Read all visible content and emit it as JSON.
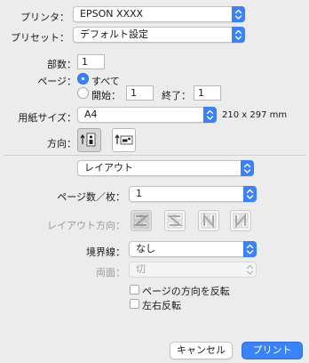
{
  "printer": {
    "label": "プリンタ：",
    "value": "EPSON XXXX"
  },
  "presets": {
    "label": "プリセット：",
    "value": "デフォルト設定"
  },
  "copies": {
    "label": "部数：",
    "value": "1"
  },
  "pages": {
    "label": "ページ：",
    "all_label": "すべて",
    "from_label": "開始：",
    "from_value": "1",
    "to_label": "終了：",
    "to_value": "1",
    "selected": "all"
  },
  "paper_size": {
    "label": "用紙サイズ：",
    "value": "A4",
    "dimensions": "210 x 297 mm"
  },
  "orientation": {
    "label": "方向：",
    "selected": "portrait"
  },
  "section": {
    "value": "レイアウト"
  },
  "layout": {
    "pages_per_sheet_label": "ページ数／枚：",
    "pages_per_sheet_value": "1",
    "layout_direction_label": "レイアウト方向：",
    "border_label": "境界線：",
    "border_value": "なし",
    "two_sided_label": "両面：",
    "two_sided_value": "切",
    "reverse_orientation_label": "ページの方向を反転",
    "flip_horizontally_label": "左右反転"
  },
  "buttons": {
    "cancel": "キャンセル",
    "print": "プリント"
  },
  "colors": {
    "accent": "#3b82f6",
    "background": "#ececec"
  }
}
